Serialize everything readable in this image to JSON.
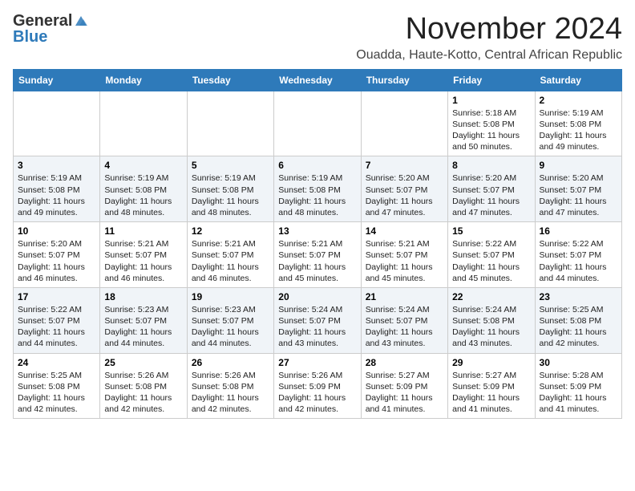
{
  "header": {
    "logo_general": "General",
    "logo_blue": "Blue",
    "month_title": "November 2024",
    "location": "Ouadda, Haute-Kotto, Central African Republic"
  },
  "days_of_week": [
    "Sunday",
    "Monday",
    "Tuesday",
    "Wednesday",
    "Thursday",
    "Friday",
    "Saturday"
  ],
  "weeks": [
    [
      {
        "day": "",
        "info": ""
      },
      {
        "day": "",
        "info": ""
      },
      {
        "day": "",
        "info": ""
      },
      {
        "day": "",
        "info": ""
      },
      {
        "day": "",
        "info": ""
      },
      {
        "day": "1",
        "info": "Sunrise: 5:18 AM\nSunset: 5:08 PM\nDaylight: 11 hours\nand 50 minutes."
      },
      {
        "day": "2",
        "info": "Sunrise: 5:19 AM\nSunset: 5:08 PM\nDaylight: 11 hours\nand 49 minutes."
      }
    ],
    [
      {
        "day": "3",
        "info": "Sunrise: 5:19 AM\nSunset: 5:08 PM\nDaylight: 11 hours\nand 49 minutes."
      },
      {
        "day": "4",
        "info": "Sunrise: 5:19 AM\nSunset: 5:08 PM\nDaylight: 11 hours\nand 48 minutes."
      },
      {
        "day": "5",
        "info": "Sunrise: 5:19 AM\nSunset: 5:08 PM\nDaylight: 11 hours\nand 48 minutes."
      },
      {
        "day": "6",
        "info": "Sunrise: 5:19 AM\nSunset: 5:08 PM\nDaylight: 11 hours\nand 48 minutes."
      },
      {
        "day": "7",
        "info": "Sunrise: 5:20 AM\nSunset: 5:07 PM\nDaylight: 11 hours\nand 47 minutes."
      },
      {
        "day": "8",
        "info": "Sunrise: 5:20 AM\nSunset: 5:07 PM\nDaylight: 11 hours\nand 47 minutes."
      },
      {
        "day": "9",
        "info": "Sunrise: 5:20 AM\nSunset: 5:07 PM\nDaylight: 11 hours\nand 47 minutes."
      }
    ],
    [
      {
        "day": "10",
        "info": "Sunrise: 5:20 AM\nSunset: 5:07 PM\nDaylight: 11 hours\nand 46 minutes."
      },
      {
        "day": "11",
        "info": "Sunrise: 5:21 AM\nSunset: 5:07 PM\nDaylight: 11 hours\nand 46 minutes."
      },
      {
        "day": "12",
        "info": "Sunrise: 5:21 AM\nSunset: 5:07 PM\nDaylight: 11 hours\nand 46 minutes."
      },
      {
        "day": "13",
        "info": "Sunrise: 5:21 AM\nSunset: 5:07 PM\nDaylight: 11 hours\nand 45 minutes."
      },
      {
        "day": "14",
        "info": "Sunrise: 5:21 AM\nSunset: 5:07 PM\nDaylight: 11 hours\nand 45 minutes."
      },
      {
        "day": "15",
        "info": "Sunrise: 5:22 AM\nSunset: 5:07 PM\nDaylight: 11 hours\nand 45 minutes."
      },
      {
        "day": "16",
        "info": "Sunrise: 5:22 AM\nSunset: 5:07 PM\nDaylight: 11 hours\nand 44 minutes."
      }
    ],
    [
      {
        "day": "17",
        "info": "Sunrise: 5:22 AM\nSunset: 5:07 PM\nDaylight: 11 hours\nand 44 minutes."
      },
      {
        "day": "18",
        "info": "Sunrise: 5:23 AM\nSunset: 5:07 PM\nDaylight: 11 hours\nand 44 minutes."
      },
      {
        "day": "19",
        "info": "Sunrise: 5:23 AM\nSunset: 5:07 PM\nDaylight: 11 hours\nand 44 minutes."
      },
      {
        "day": "20",
        "info": "Sunrise: 5:24 AM\nSunset: 5:07 PM\nDaylight: 11 hours\nand 43 minutes."
      },
      {
        "day": "21",
        "info": "Sunrise: 5:24 AM\nSunset: 5:07 PM\nDaylight: 11 hours\nand 43 minutes."
      },
      {
        "day": "22",
        "info": "Sunrise: 5:24 AM\nSunset: 5:08 PM\nDaylight: 11 hours\nand 43 minutes."
      },
      {
        "day": "23",
        "info": "Sunrise: 5:25 AM\nSunset: 5:08 PM\nDaylight: 11 hours\nand 42 minutes."
      }
    ],
    [
      {
        "day": "24",
        "info": "Sunrise: 5:25 AM\nSunset: 5:08 PM\nDaylight: 11 hours\nand 42 minutes."
      },
      {
        "day": "25",
        "info": "Sunrise: 5:26 AM\nSunset: 5:08 PM\nDaylight: 11 hours\nand 42 minutes."
      },
      {
        "day": "26",
        "info": "Sunrise: 5:26 AM\nSunset: 5:08 PM\nDaylight: 11 hours\nand 42 minutes."
      },
      {
        "day": "27",
        "info": "Sunrise: 5:26 AM\nSunset: 5:09 PM\nDaylight: 11 hours\nand 42 minutes."
      },
      {
        "day": "28",
        "info": "Sunrise: 5:27 AM\nSunset: 5:09 PM\nDaylight: 11 hours\nand 41 minutes."
      },
      {
        "day": "29",
        "info": "Sunrise: 5:27 AM\nSunset: 5:09 PM\nDaylight: 11 hours\nand 41 minutes."
      },
      {
        "day": "30",
        "info": "Sunrise: 5:28 AM\nSunset: 5:09 PM\nDaylight: 11 hours\nand 41 minutes."
      }
    ]
  ]
}
